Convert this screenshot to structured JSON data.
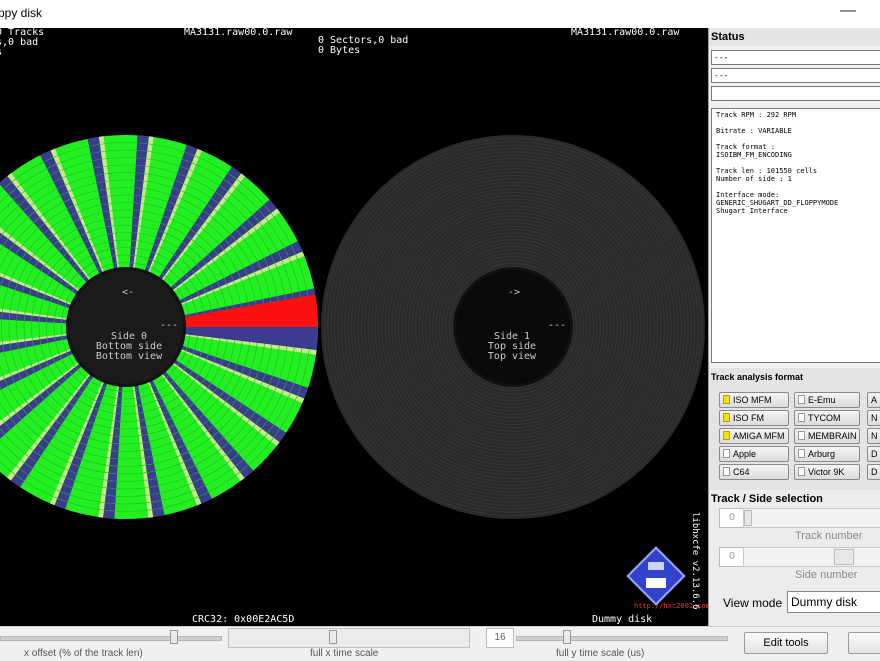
{
  "window": {
    "title": "ppy disk",
    "minimize_glyph": "—"
  },
  "viewer": {
    "left": {
      "header_lines": "0 Tracks\ns,0 bad\ns",
      "filename": "MA3131.raw00.0.raw",
      "arrow": "<-",
      "dash": "---",
      "side_lines": "Side 0\nBottom side\nBottom view",
      "crc": "CRC32: 0x00E2AC5D"
    },
    "right": {
      "header_lines": "0 Sectors,0 bad\n0 Bytes",
      "filename": "MA3131.raw00.0.raw",
      "arrow": "->",
      "dash": "---",
      "side_lines": "Side 1\nTop side\nTop view",
      "footer": "Dummy disk"
    },
    "version": "libhxcfe v2.13.6.6",
    "logo_text": "HxC2001",
    "url": "http://hxc2001.com"
  },
  "status": {
    "header": "Status",
    "field1": "---",
    "field2": "---",
    "field3": "",
    "info_text": "Track RPM : 292 RPM\n\nBitrate : VARIABLE\n\nTrack format :\nISOIBM_FM_ENCODING\n\nTrack len : 101550 cells\nNumber of side : 1\n\nInterface mode:\nGENERIC_SHUGART_DD_FLOPPYMODE\nShugart Interface"
  },
  "track_format": {
    "header": "Track analysis format",
    "col1": [
      {
        "label": "ISO MFM",
        "checked": true
      },
      {
        "label": "ISO FM",
        "checked": true
      },
      {
        "label": "AMIGA MFM",
        "checked": true
      },
      {
        "label": "Apple",
        "checked": false
      },
      {
        "label": "C64",
        "checked": false
      }
    ],
    "col2": [
      {
        "label": "E-Emu",
        "checked": false
      },
      {
        "label": "TYCOM",
        "checked": false
      },
      {
        "label": "MEMBRAIN",
        "checked": false
      },
      {
        "label": "Arburg",
        "checked": false
      },
      {
        "label": "Victor 9K",
        "checked": false
      }
    ],
    "col3": [
      "A",
      "N",
      "N",
      "D",
      "D"
    ]
  },
  "track_side": {
    "header": "Track / Side selection",
    "track_value": "0",
    "track_label": "Track number",
    "side_value": "0",
    "side_label": "Side number",
    "view_mode_label": "View mode",
    "view_mode_value": "Dummy disk"
  },
  "bottom": {
    "x_offset_label": "x offset (% of the track len)",
    "x_scale_label": "full x time scale",
    "y_value": "16",
    "y_scale_label": "full y time scale (us)",
    "edit_tools": "Edit tools"
  },
  "colors": {
    "track_green": "#22ee22",
    "gap_blue": "#3b3b8f",
    "error_red": "#ff1010",
    "empty_disk": "#2a2a2a",
    "checked_yellow": "#f7e200"
  }
}
